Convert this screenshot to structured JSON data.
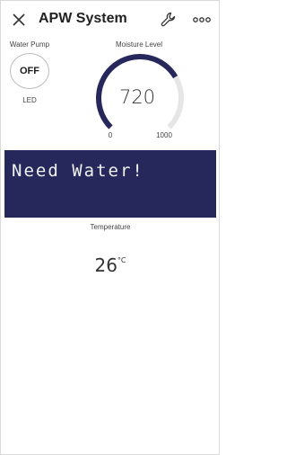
{
  "header": {
    "title": "APW System"
  },
  "water_pump": {
    "label": "Water Pump",
    "state": "OFF",
    "led_label": "LED"
  },
  "moisture": {
    "label": "Moisture Level",
    "value": "720",
    "min": "0",
    "max": "1000"
  },
  "lcd": {
    "text": "Need Water!"
  },
  "temperature": {
    "label": "Temperature",
    "value": "26",
    "unit": "°C"
  },
  "colors": {
    "accent": "#26285c",
    "gauge_track": "#e6e6e6",
    "gauge_fill": "#26285c"
  },
  "icons": [
    "close-icon",
    "wrench-icon",
    "more-icon"
  ]
}
